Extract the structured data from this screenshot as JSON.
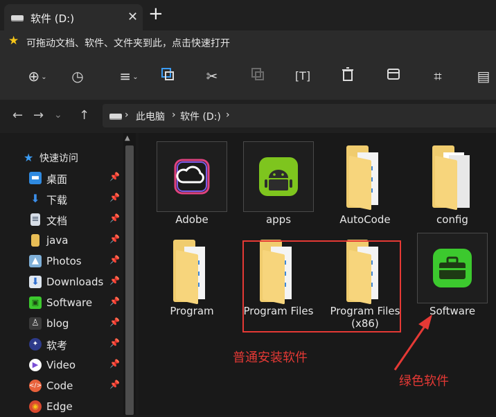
{
  "tab": {
    "title": "软件 (D:)",
    "close": "✕",
    "new": "+"
  },
  "favorites_bar": {
    "text": "可拖动文档、软件、文件夹到此，点击快速打开"
  },
  "address": {
    "root": "此电脑",
    "drive": "软件 (D:)",
    "sep": "›"
  },
  "sidebar": {
    "quick_access": "快速访问",
    "items": [
      {
        "label": "桌面",
        "icon": "desktop-icon",
        "color": "#2f8ae0"
      },
      {
        "label": "下载",
        "icon": "download-icon",
        "color": "#3b8ee8"
      },
      {
        "label": "文档",
        "icon": "document-icon",
        "color": "#8aa0b8"
      },
      {
        "label": "java",
        "icon": "folder-icon",
        "color": "#e8bd55"
      },
      {
        "label": "Photos",
        "icon": "photos-icon",
        "color": "#7fb0d8"
      },
      {
        "label": "Downloads",
        "icon": "downloads-icon",
        "color": "#3b8ee8"
      },
      {
        "label": "Software",
        "icon": "toolbox-icon",
        "color": "#3cc92e"
      },
      {
        "label": "blog",
        "icon": "user-icon",
        "color": "#555555"
      },
      {
        "label": "软考",
        "icon": "exam-icon",
        "color": "#2d3a8a"
      },
      {
        "label": "Video",
        "icon": "video-icon",
        "color": "#7b4fd6"
      },
      {
        "label": "Code",
        "icon": "code-icon",
        "color": "#e8613b"
      },
      {
        "label": "Edge",
        "icon": "edge-icon",
        "color": "#d9492f"
      }
    ]
  },
  "content": {
    "items": [
      {
        "label": "Adobe"
      },
      {
        "label": "apps"
      },
      {
        "label": "AutoCode"
      },
      {
        "label": "config"
      },
      {
        "label": "Program"
      },
      {
        "label": "Program Files"
      },
      {
        "label": "Program Files (x86)"
      },
      {
        "label": "Software"
      }
    ]
  },
  "annotations": {
    "normal_install": "普通安装软件",
    "portable": "绿色软件"
  },
  "colors": {
    "accent": "#e53935",
    "folder": "#f0cc6e",
    "software_green": "#3cc92e"
  }
}
